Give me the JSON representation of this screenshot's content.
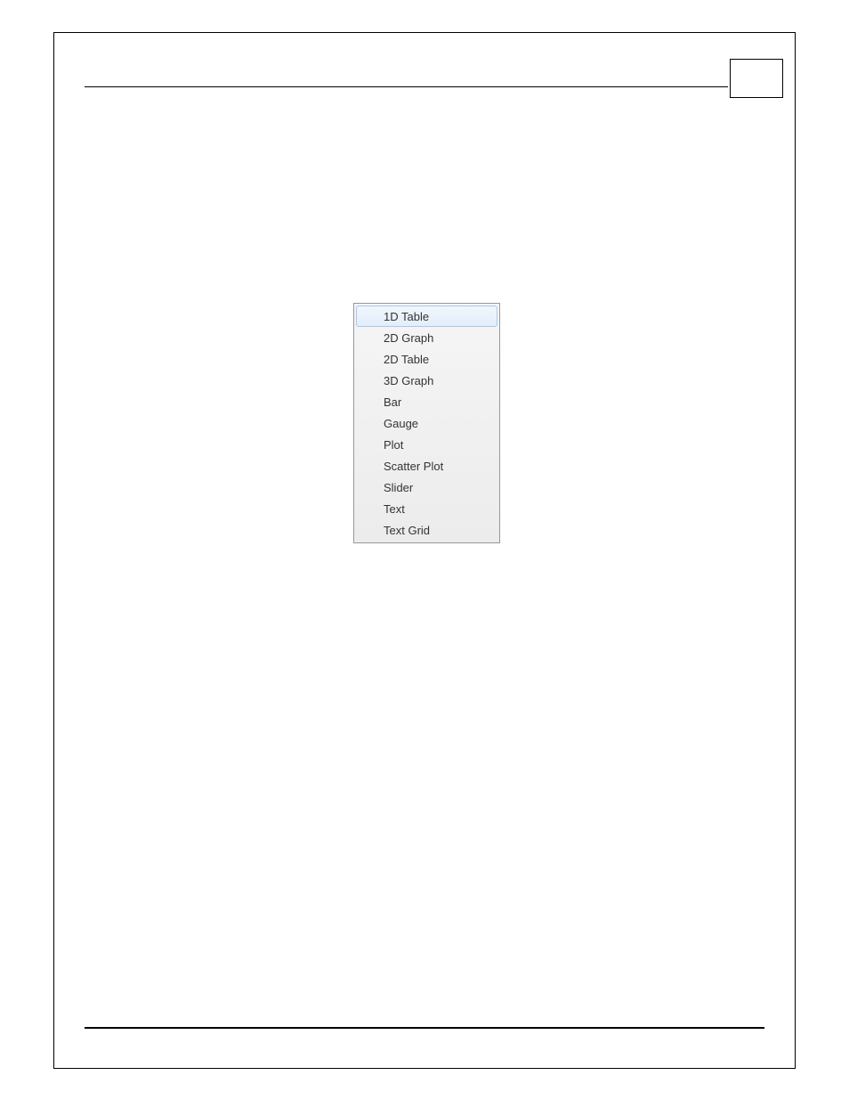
{
  "menu": {
    "items": [
      {
        "label": "1D Table",
        "highlighted": true
      },
      {
        "label": "2D Graph",
        "highlighted": false
      },
      {
        "label": "2D Table",
        "highlighted": false
      },
      {
        "label": "3D Graph",
        "highlighted": false
      },
      {
        "label": "Bar",
        "highlighted": false
      },
      {
        "label": "Gauge",
        "highlighted": false
      },
      {
        "label": "Plot",
        "highlighted": false
      },
      {
        "label": "Scatter Plot",
        "highlighted": false
      },
      {
        "label": "Slider",
        "highlighted": false
      },
      {
        "label": "Text",
        "highlighted": false
      },
      {
        "label": "Text Grid",
        "highlighted": false
      }
    ]
  }
}
